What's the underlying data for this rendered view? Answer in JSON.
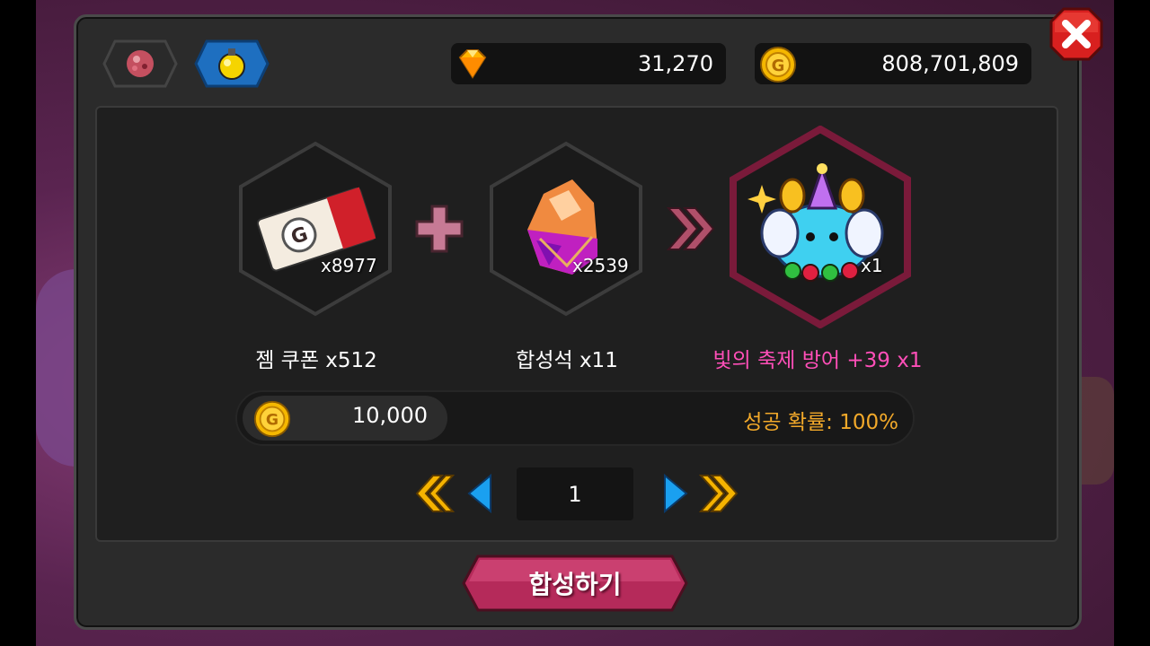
{
  "currency": {
    "gems": "31,270",
    "gold": "808,701,809"
  },
  "tabs": [
    {
      "icon": "gem-ore-icon",
      "active": false
    },
    {
      "icon": "potion-icon",
      "active": true
    }
  ],
  "recipe": {
    "ingredient1": {
      "icon": "gem-coupon-icon",
      "count": "x8977",
      "label": "젬 쿠폰  x512"
    },
    "ingredient2": {
      "icon": "synthesis-stone-icon",
      "count": "x2539",
      "label": "합성석 x11"
    },
    "result": {
      "icon": "festival-defense-pet-icon",
      "count": "x1",
      "label": "빛의 축제 방어 +39  x1"
    }
  },
  "cost": {
    "value": "10,000",
    "success_rate": "성공 확률: 100%"
  },
  "pagination": {
    "current": "1"
  },
  "action": {
    "synthesize_label": "합성하기"
  },
  "colors": {
    "result_border": "#7a1a3a",
    "success_rate": "#f2a92a",
    "result_label": "#ff4fb8"
  }
}
